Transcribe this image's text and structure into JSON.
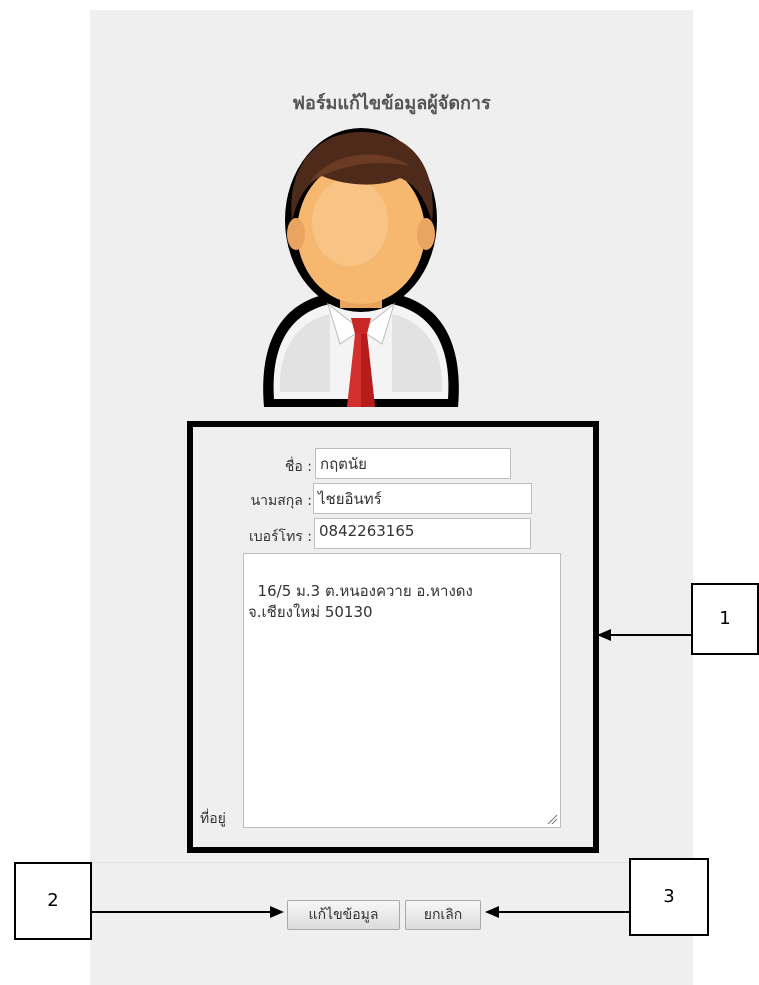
{
  "form": {
    "title": "ฟอร์มแก้ไขข้อมูลผู้จัดการ",
    "fields": {
      "first_name": {
        "label": "ชื่อ :",
        "value": "กฤตนัย"
      },
      "last_name": {
        "label": "นามสกุล :",
        "value": "ไชยอินทร์"
      },
      "phone": {
        "label": "เบอร์โทร :",
        "value": "0842263165"
      },
      "address": {
        "label": "ที่อยู่",
        "value": "16/5 ม.3 ต.หนองควาย อ.หางดง\nจ.เชียงใหม่ 50130"
      }
    },
    "buttons": {
      "edit": "แก้ไขข้อมูล",
      "cancel": "ยกเลิก"
    }
  },
  "callouts": {
    "one": "1",
    "two": "2",
    "three": "3"
  },
  "icons": {
    "avatar": "manager-avatar-icon"
  },
  "colors": {
    "panel_bg": "#efefef",
    "tie_red": "#d32f2f",
    "highlight_border": "#000000"
  }
}
